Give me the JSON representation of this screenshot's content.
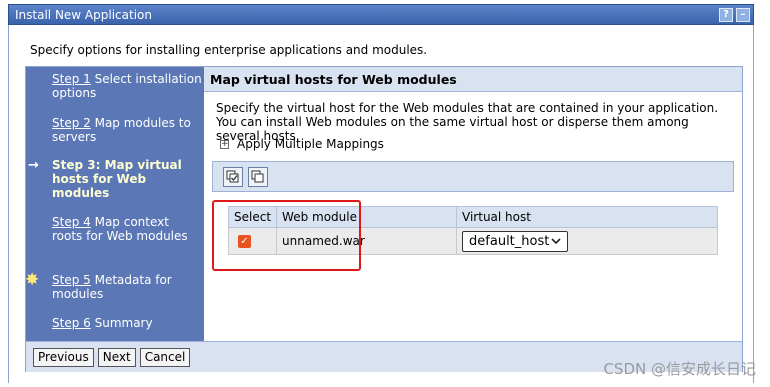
{
  "window": {
    "title": "Install New Application",
    "help_icon": "?",
    "minimize_icon": "–"
  },
  "intro": "Specify options for installing enterprise applications and modules.",
  "steps": [
    {
      "link": "Step 1",
      "text": " Select installation options"
    },
    {
      "link": "Step 2",
      "text": " Map modules to servers"
    },
    {
      "text": "Step 3: Map virtual hosts for Web modules",
      "icon": "arrow-right-icon"
    },
    {
      "link": "Step 4",
      "text": " Map context roots for Web modules"
    },
    {
      "link": "Step 5",
      "text": " Metadata for modules",
      "icon": "star-icon"
    },
    {
      "link": "Step 6",
      "text": " Summary"
    }
  ],
  "content": {
    "header": "Map virtual hosts for Web modules",
    "description": "Specify the virtual host for the Web modules that are contained in your application. You can install Web modules on the same virtual host or disperse them among several hosts.",
    "apply_label": "Apply Multiple Mappings"
  },
  "table": {
    "headers": [
      "Select",
      "Web module",
      "Virtual host"
    ],
    "rows": [
      {
        "selected": true,
        "module": "unnamed.war",
        "virtual_host": "default_host"
      }
    ]
  },
  "buttons": {
    "previous": "Previous",
    "next": "Next",
    "cancel": "Cancel"
  },
  "watermark": "CSDN @信安成长日记",
  "colors": {
    "nav_bg": "#5b77b5",
    "header_bg": "#d8e2f1",
    "checkbox": "#e8531f",
    "highlight": "#e01818"
  }
}
